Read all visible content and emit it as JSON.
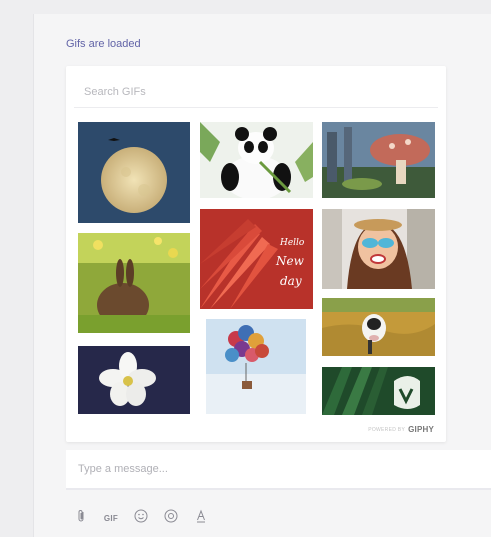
{
  "status": "Gifs are loaded",
  "search": {
    "placeholder": "Search GIFs",
    "value": ""
  },
  "gifs": [
    {
      "subject": "full-moon-with-bird"
    },
    {
      "subject": "panda-eating-bamboo"
    },
    {
      "subject": "mushroom-forest"
    },
    {
      "subject": "red-flower-new-day"
    },
    {
      "subject": "woman-with-sunglasses"
    },
    {
      "subject": "brown-rabbit-in-grass"
    },
    {
      "subject": "cow-in-field"
    },
    {
      "subject": "balloons-house-in-sky"
    },
    {
      "subject": "white-flower"
    },
    {
      "subject": "green-leaves-logo"
    }
  ],
  "gif_overlay": {
    "line1": "Hello",
    "line2": "New",
    "line3": "day"
  },
  "attribution": {
    "prefix": "POWERED BY",
    "brand": "GIPHY"
  },
  "composer": {
    "placeholder": "Type a message...",
    "value": ""
  },
  "toolbar": {
    "gif_label": "GIF",
    "icons": [
      "paperclip-icon",
      "gif-icon",
      "emoji-icon",
      "sticker-icon",
      "format-icon"
    ]
  },
  "colors": {
    "accent": "#6264a7",
    "background": "#eeeef0",
    "panel": "#f5f5f6"
  }
}
